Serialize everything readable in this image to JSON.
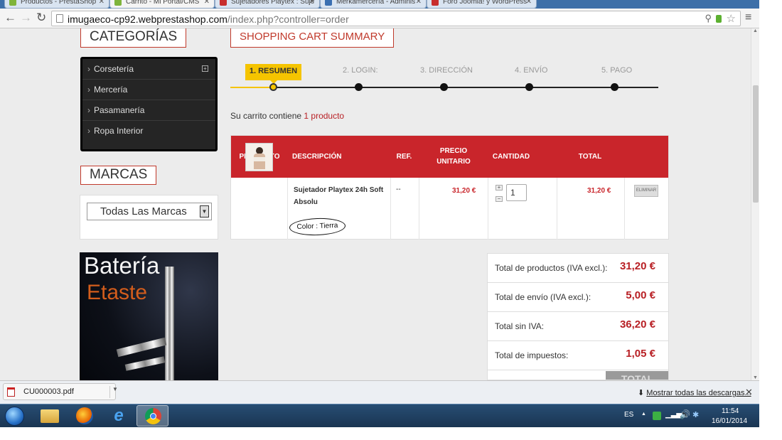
{
  "browser": {
    "tabs": [
      {
        "label": "Productos - PrestaShop",
        "color": "#7fb43b"
      },
      {
        "label": "Carrito - Mi Portal/CMS",
        "color": "#7fb43b",
        "active": true
      },
      {
        "label": "Sujetadores Playtex : Suje",
        "color": "#c82d2d"
      },
      {
        "label": "Merkamercería - Adminis",
        "color": "#3a6fb1"
      },
      {
        "label": "Foro Joomla! y WordPress",
        "color": "#c82d2d"
      }
    ],
    "url_domain": "imugaeco-cp92.webprestashop.com",
    "url_path": "/index.php?controller=order"
  },
  "sidebar": {
    "categories_title": "CATEGORÍAS",
    "categories": [
      "Corsetería",
      "Mercería",
      "Pasamanería",
      "Ropa Interior"
    ],
    "brands_title": "MARCAS",
    "brands_selected": "Todas Las Marcas",
    "banner_line1": "Batería",
    "banner_line2": "Etaste"
  },
  "cart": {
    "title": "SHOPPING CART SUMMARY",
    "steps": [
      "1. RESUMEN",
      "2. LOGIN:",
      "3. DIRECCIÓN",
      "4. ENVÍO",
      "5. PAGO"
    ],
    "summary_text": "Su carrito contiene ",
    "summary_link": "1 producto",
    "columns": [
      "PRODUCTO",
      "DESCRIPCIÓN",
      "REF.",
      "PRECIO UNITARIO",
      "CANTIDAD",
      "TOTAL"
    ],
    "item": {
      "name": "Sujetador Playtex 24h Soft Absolu",
      "ref": "--",
      "unit_price": "31,20 €",
      "quantity": "1",
      "total": "31,20 €",
      "delete_label": "ELIMINAR",
      "color_label": "Color : Tierra"
    },
    "totals": [
      {
        "label": "Total de productos (IVA excl.):",
        "value": "31,20 €"
      },
      {
        "label": "Total de envío (IVA excl.):",
        "value": "5,00 €"
      },
      {
        "label": "Total sin IVA:",
        "value": "36,20 €"
      },
      {
        "label": "Total de impuestos:",
        "value": "1,05 €"
      }
    ],
    "total_header": "TOTAL"
  },
  "downloads": {
    "file": "CU000003.pdf",
    "show_all": "Mostrar todas las descargas..."
  },
  "taskbar": {
    "lang": "ES",
    "time": "11:54",
    "date": "16/01/2014"
  },
  "colors": {
    "accent_red": "#c9252b",
    "step_yellow": "#f5c400"
  }
}
